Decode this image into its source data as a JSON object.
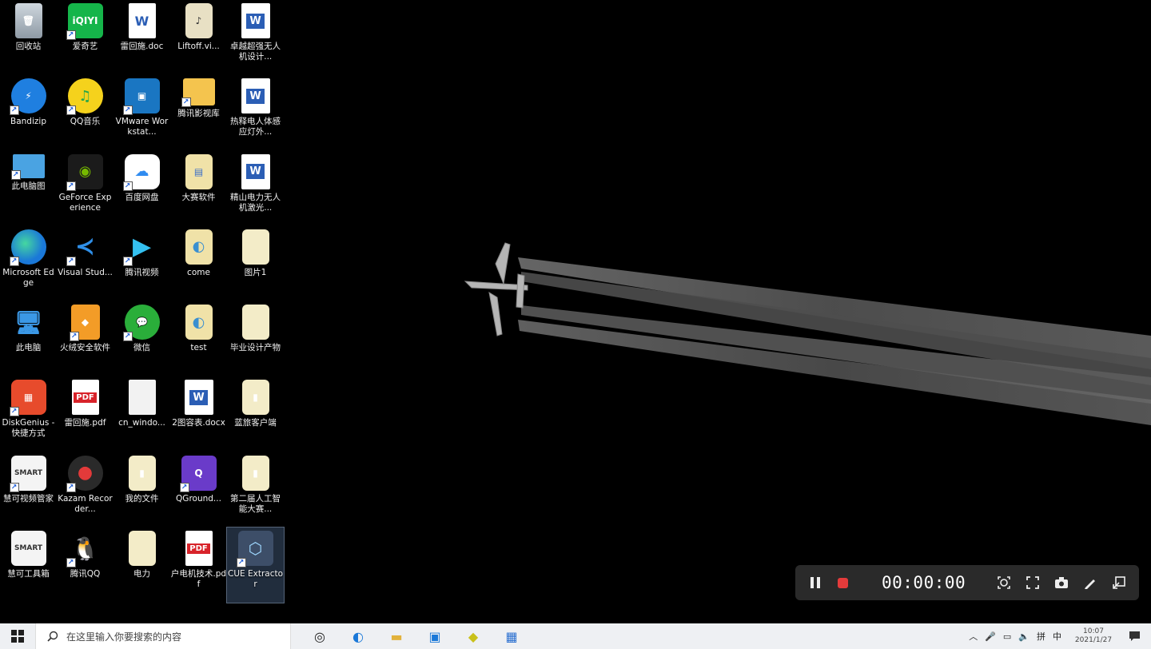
{
  "desktop": {
    "icons": [
      {
        "label": "回收站",
        "glyph": "🗑"
      },
      {
        "label": "爱奇艺",
        "glyph": "iQIYI"
      },
      {
        "label": "雷回施.doc",
        "glyph": "W"
      },
      {
        "label": "Liftoff.vi...",
        "glyph": "♪"
      },
      {
        "label": "卓越超强无人机设计...",
        "glyph": "W"
      },
      {
        "label": "Bandizip",
        "glyph": "⚡"
      },
      {
        "label": "QQ音乐",
        "glyph": "♫"
      },
      {
        "label": "VMware Workstat...",
        "glyph": "▣"
      },
      {
        "label": "腾讯影视库",
        "glyph": ""
      },
      {
        "label": "热释电人体感应灯外...",
        "glyph": "W"
      },
      {
        "label": "此电脑图",
        "glyph": ""
      },
      {
        "label": "GeForce Experience",
        "glyph": "◉"
      },
      {
        "label": "百度网盘",
        "glyph": "☁"
      },
      {
        "label": "大赛软件",
        "glyph": "▤"
      },
      {
        "label": "精山电力无人机激光...",
        "glyph": "W"
      },
      {
        "label": "Microsoft Edge",
        "glyph": ""
      },
      {
        "label": "Visual Stud...",
        "glyph": "≺"
      },
      {
        "label": "腾讯视频",
        "glyph": "▶"
      },
      {
        "label": "come",
        "glyph": "◐"
      },
      {
        "label": "图片1",
        "glyph": ""
      },
      {
        "label": "此电脑",
        "glyph": "🖥"
      },
      {
        "label": "火绒安全软件",
        "glyph": "◆"
      },
      {
        "label": "微信",
        "glyph": "💬"
      },
      {
        "label": "test",
        "glyph": "◐"
      },
      {
        "label": "毕业设计产物",
        "glyph": ""
      },
      {
        "label": "DiskGenius - 快捷方式",
        "glyph": "▦"
      },
      {
        "label": "雷回施.pdf",
        "glyph": "PDF"
      },
      {
        "label": "cn_windo...",
        "glyph": ""
      },
      {
        "label": "2图容表.docx",
        "glyph": "W"
      },
      {
        "label": "蓝旅客户端",
        "glyph": "▮"
      },
      {
        "label": "慧可视频管家",
        "glyph": "SMART"
      },
      {
        "label": "Kazam Recorder...",
        "glyph": "●"
      },
      {
        "label": "我的文件",
        "glyph": "▮"
      },
      {
        "label": "QGround...",
        "glyph": "Q"
      },
      {
        "label": "第二届人工智能大赛...",
        "glyph": "▮"
      },
      {
        "label": "慧可工具箱",
        "glyph": "SMART"
      },
      {
        "label": "腾讯QQ",
        "glyph": "🐧"
      },
      {
        "label": "电力",
        "glyph": ""
      },
      {
        "label": "户电机技术.pdf",
        "glyph": "PDF"
      },
      {
        "label": "CUE Extractor",
        "glyph": "⬡"
      }
    ]
  },
  "recorder": {
    "time": "00:00:00",
    "pause_icon": "pause-icon",
    "stop_icon": "stop-icon",
    "tools": [
      "focus-icon",
      "fullscreen-icon",
      "camera-icon",
      "pen-icon",
      "minimize-icon"
    ]
  },
  "taskbar": {
    "search_placeholder": "在这里输入你要搜索的内容",
    "apps": [
      {
        "name": "task-view",
        "glyph": "◎"
      },
      {
        "name": "edge",
        "glyph": "◐"
      },
      {
        "name": "file-explorer",
        "glyph": "▬"
      },
      {
        "name": "store",
        "glyph": "▣"
      },
      {
        "name": "app-yellow",
        "glyph": "◆"
      },
      {
        "name": "app-blue",
        "glyph": "▦"
      }
    ],
    "tray": {
      "ime_1": "拼",
      "ime_2": "中",
      "time": "10:07",
      "date": "2021/1/27"
    }
  },
  "colors": {
    "desktop_bg": "#000000",
    "taskbar_bg": "#eef0f3",
    "recorder_bg": "#2a2a2a",
    "record_red": "#e43b3b"
  }
}
